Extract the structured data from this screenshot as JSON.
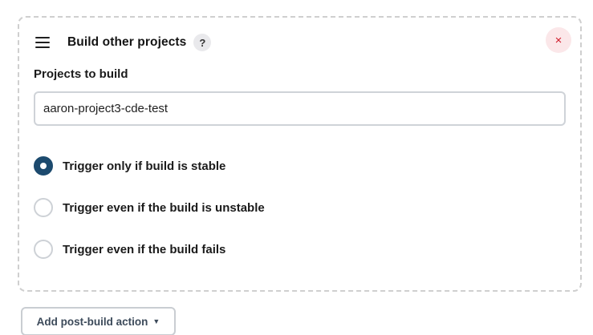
{
  "section": {
    "title": "Build other projects",
    "help_label": "?",
    "close_label": "×",
    "drag_icon": "hamburger-icon"
  },
  "projects_field": {
    "label": "Projects to build",
    "value": "aaron-project3-cde-test"
  },
  "trigger_options": [
    {
      "label": "Trigger only if build is stable",
      "selected": true
    },
    {
      "label": "Trigger even if the build is unstable",
      "selected": false
    },
    {
      "label": "Trigger even if the build fails",
      "selected": false
    }
  ],
  "footer": {
    "add_action_label": "Add post-build action",
    "caret": "▼"
  },
  "colors": {
    "radio_selected": "#1c4a6e",
    "close_icon": "#d01a2a",
    "close_bg": "#fbe7e9",
    "dashed_border": "#cfcfcf"
  }
}
